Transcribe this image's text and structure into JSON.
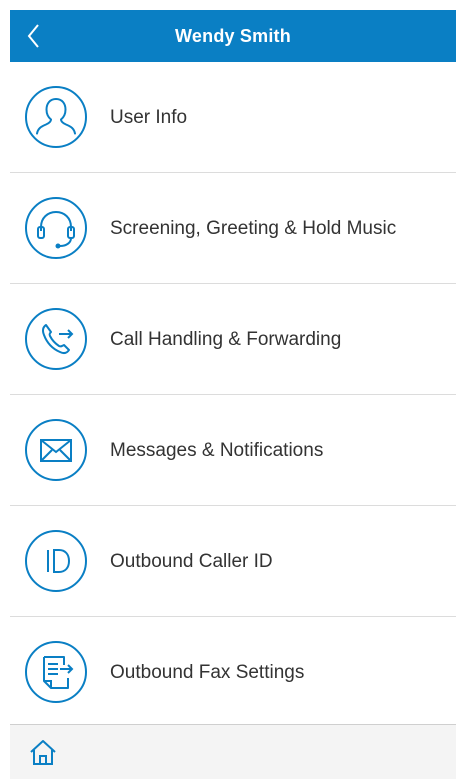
{
  "header": {
    "title": "Wendy Smith",
    "back_icon": "chevron-left-icon"
  },
  "menu": {
    "items": [
      {
        "label": "User Info",
        "icon": "user-icon"
      },
      {
        "label": "Screening, Greeting & Hold Music",
        "icon": "headset-icon"
      },
      {
        "label": "Call Handling & Forwarding",
        "icon": "phone-forward-icon"
      },
      {
        "label": "Messages & Notifications",
        "icon": "envelope-icon"
      },
      {
        "label": "Outbound Caller ID",
        "icon": "caller-id-icon"
      },
      {
        "label": "Outbound Fax Settings",
        "icon": "fax-icon"
      }
    ]
  },
  "footer": {
    "home_icon": "home-icon"
  },
  "colors": {
    "accent": "#0a7fc4",
    "text": "#333333",
    "divider": "#dcdcdc",
    "footer_bg": "#f4f4f4"
  }
}
